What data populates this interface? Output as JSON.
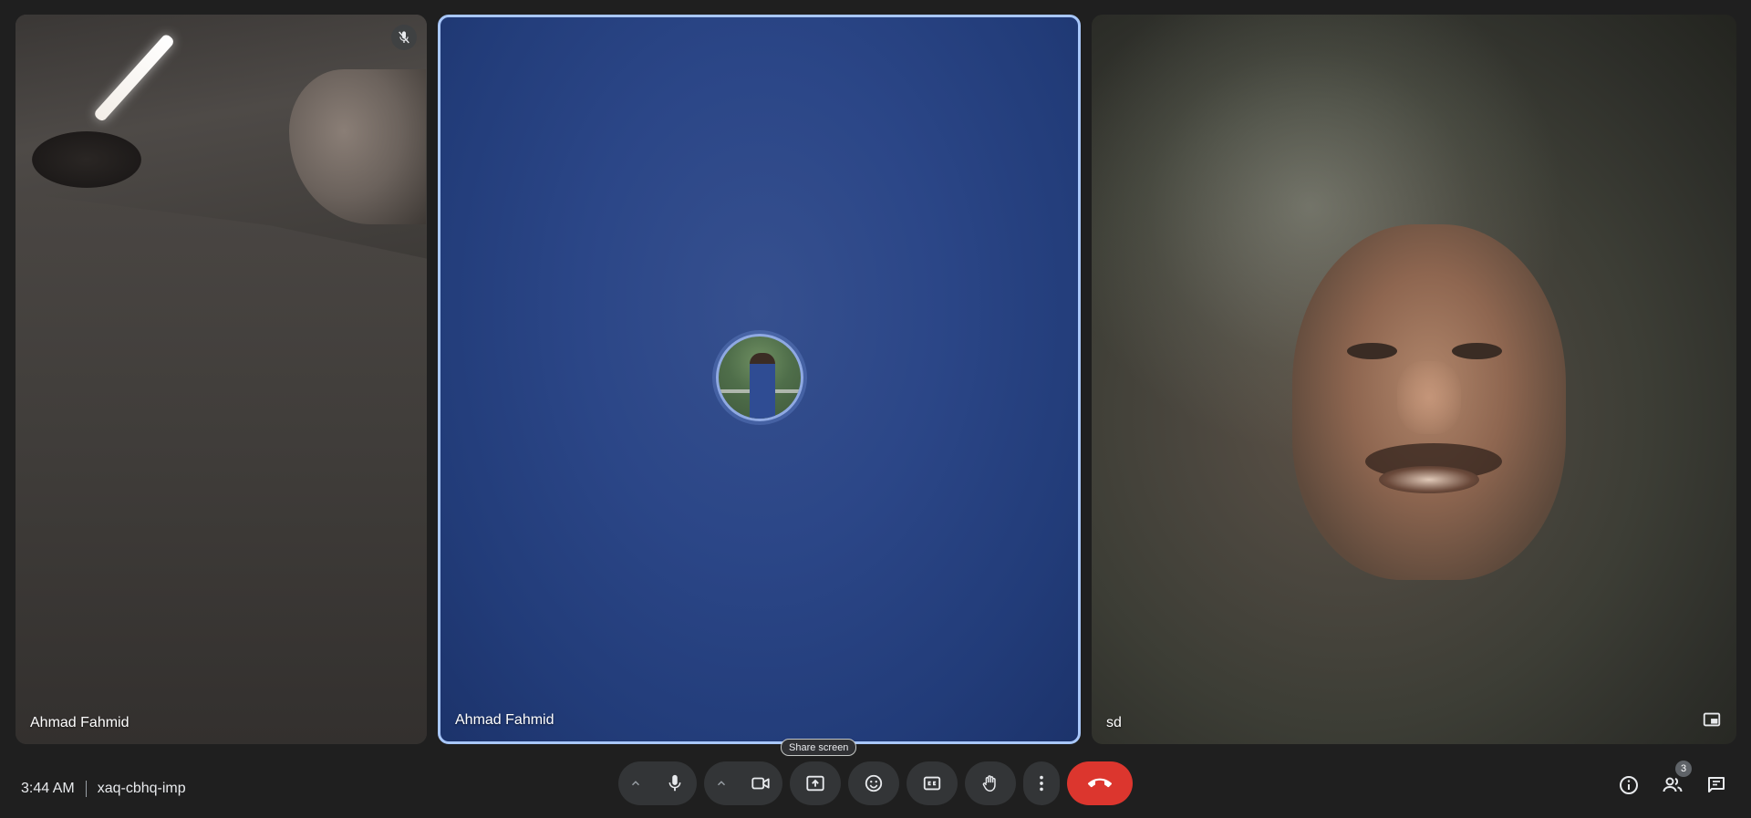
{
  "tiles": [
    {
      "name": "Ahmad Fahmid",
      "muted": true,
      "video": true
    },
    {
      "name": "Ahmad Fahmid",
      "muted": false,
      "video": false,
      "active_speaker": true
    },
    {
      "name": "sd",
      "muted": false,
      "video": true
    }
  ],
  "meeting": {
    "time": "3:44 AM",
    "code": "xaq-cbhq-imp"
  },
  "controls": {
    "tooltip": "Share screen",
    "participants_count": "3",
    "hangup_color": "#dc362e",
    "active_border_color": "#a8c7fa"
  },
  "icons": {
    "mute": "mic-off-icon",
    "mic": "mic-icon",
    "camera": "videocam-icon",
    "present": "present-to-all-icon",
    "reactions": "emoji-icon",
    "captions": "closed-caption-icon",
    "raise_hand": "hand-icon",
    "more": "more-vert-icon",
    "hangup": "call-end-icon",
    "info": "info-icon",
    "people": "people-icon",
    "chat": "chat-icon",
    "pip": "picture-in-picture-icon"
  }
}
